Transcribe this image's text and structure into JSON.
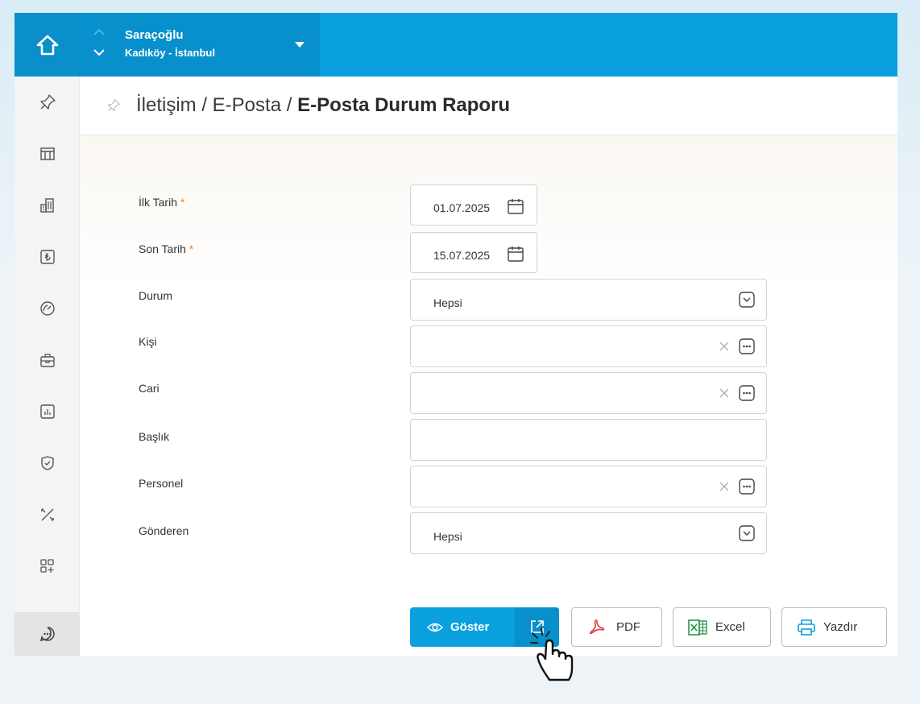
{
  "company": {
    "name": "Saraçoğlu",
    "location": "Kadıköy - İstanbul"
  },
  "breadcrumb": {
    "part1": "İletişim / E-Posta / ",
    "current": "E-Posta Durum Raporu"
  },
  "form": {
    "ilk_tarih": {
      "label": "İlk Tarih",
      "required": "*",
      "value": "01.07.2025"
    },
    "son_tarih": {
      "label": "Son Tarih",
      "required": "*",
      "value": "15.07.2025"
    },
    "durum": {
      "label": "Durum",
      "value": "Hepsi"
    },
    "kisi": {
      "label": "Kişi",
      "value": ""
    },
    "cari": {
      "label": "Cari",
      "value": ""
    },
    "baslik": {
      "label": "Başlık",
      "value": ""
    },
    "personel": {
      "label": "Personel",
      "value": ""
    },
    "gonderen": {
      "label": "Gönderen",
      "value": "Hepsi"
    }
  },
  "buttons": {
    "show": "Göster",
    "pdf": "PDF",
    "excel": "Excel",
    "print": "Yazdır"
  },
  "colors": {
    "brand": "#0aa0de",
    "brand_dark": "#0890cc",
    "required": "#f0801f",
    "pdf_red": "#e03a3a",
    "excel_green": "#1e8e3e"
  },
  "sidebar_icons": [
    "pin-icon",
    "table-icon",
    "building-icon",
    "lira-icon",
    "gauge-icon",
    "briefcase-icon",
    "chart-icon",
    "shield-icon",
    "tools-icon",
    "apps-add-icon",
    "chat-icon"
  ]
}
